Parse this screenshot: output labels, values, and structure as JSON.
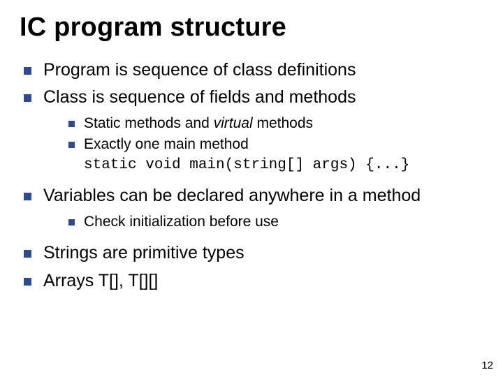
{
  "title": "IC program structure",
  "bullets": {
    "b1": "Program is sequence of class definitions",
    "b2": "Class is sequence of fields and methods",
    "b2sub": {
      "a_pre": "Static methods and ",
      "a_it": "virtual",
      "a_post": " methods",
      "b_line1": "Exactly one main method",
      "b_line2": "static void main(string[] args) {...}"
    },
    "b3": "Variables can be declared anywhere in a method",
    "b3sub": {
      "a": "Check initialization before use"
    },
    "b4": "Strings are primitive types",
    "b5": "Arrays T[], T[][]"
  },
  "page_number": "12"
}
